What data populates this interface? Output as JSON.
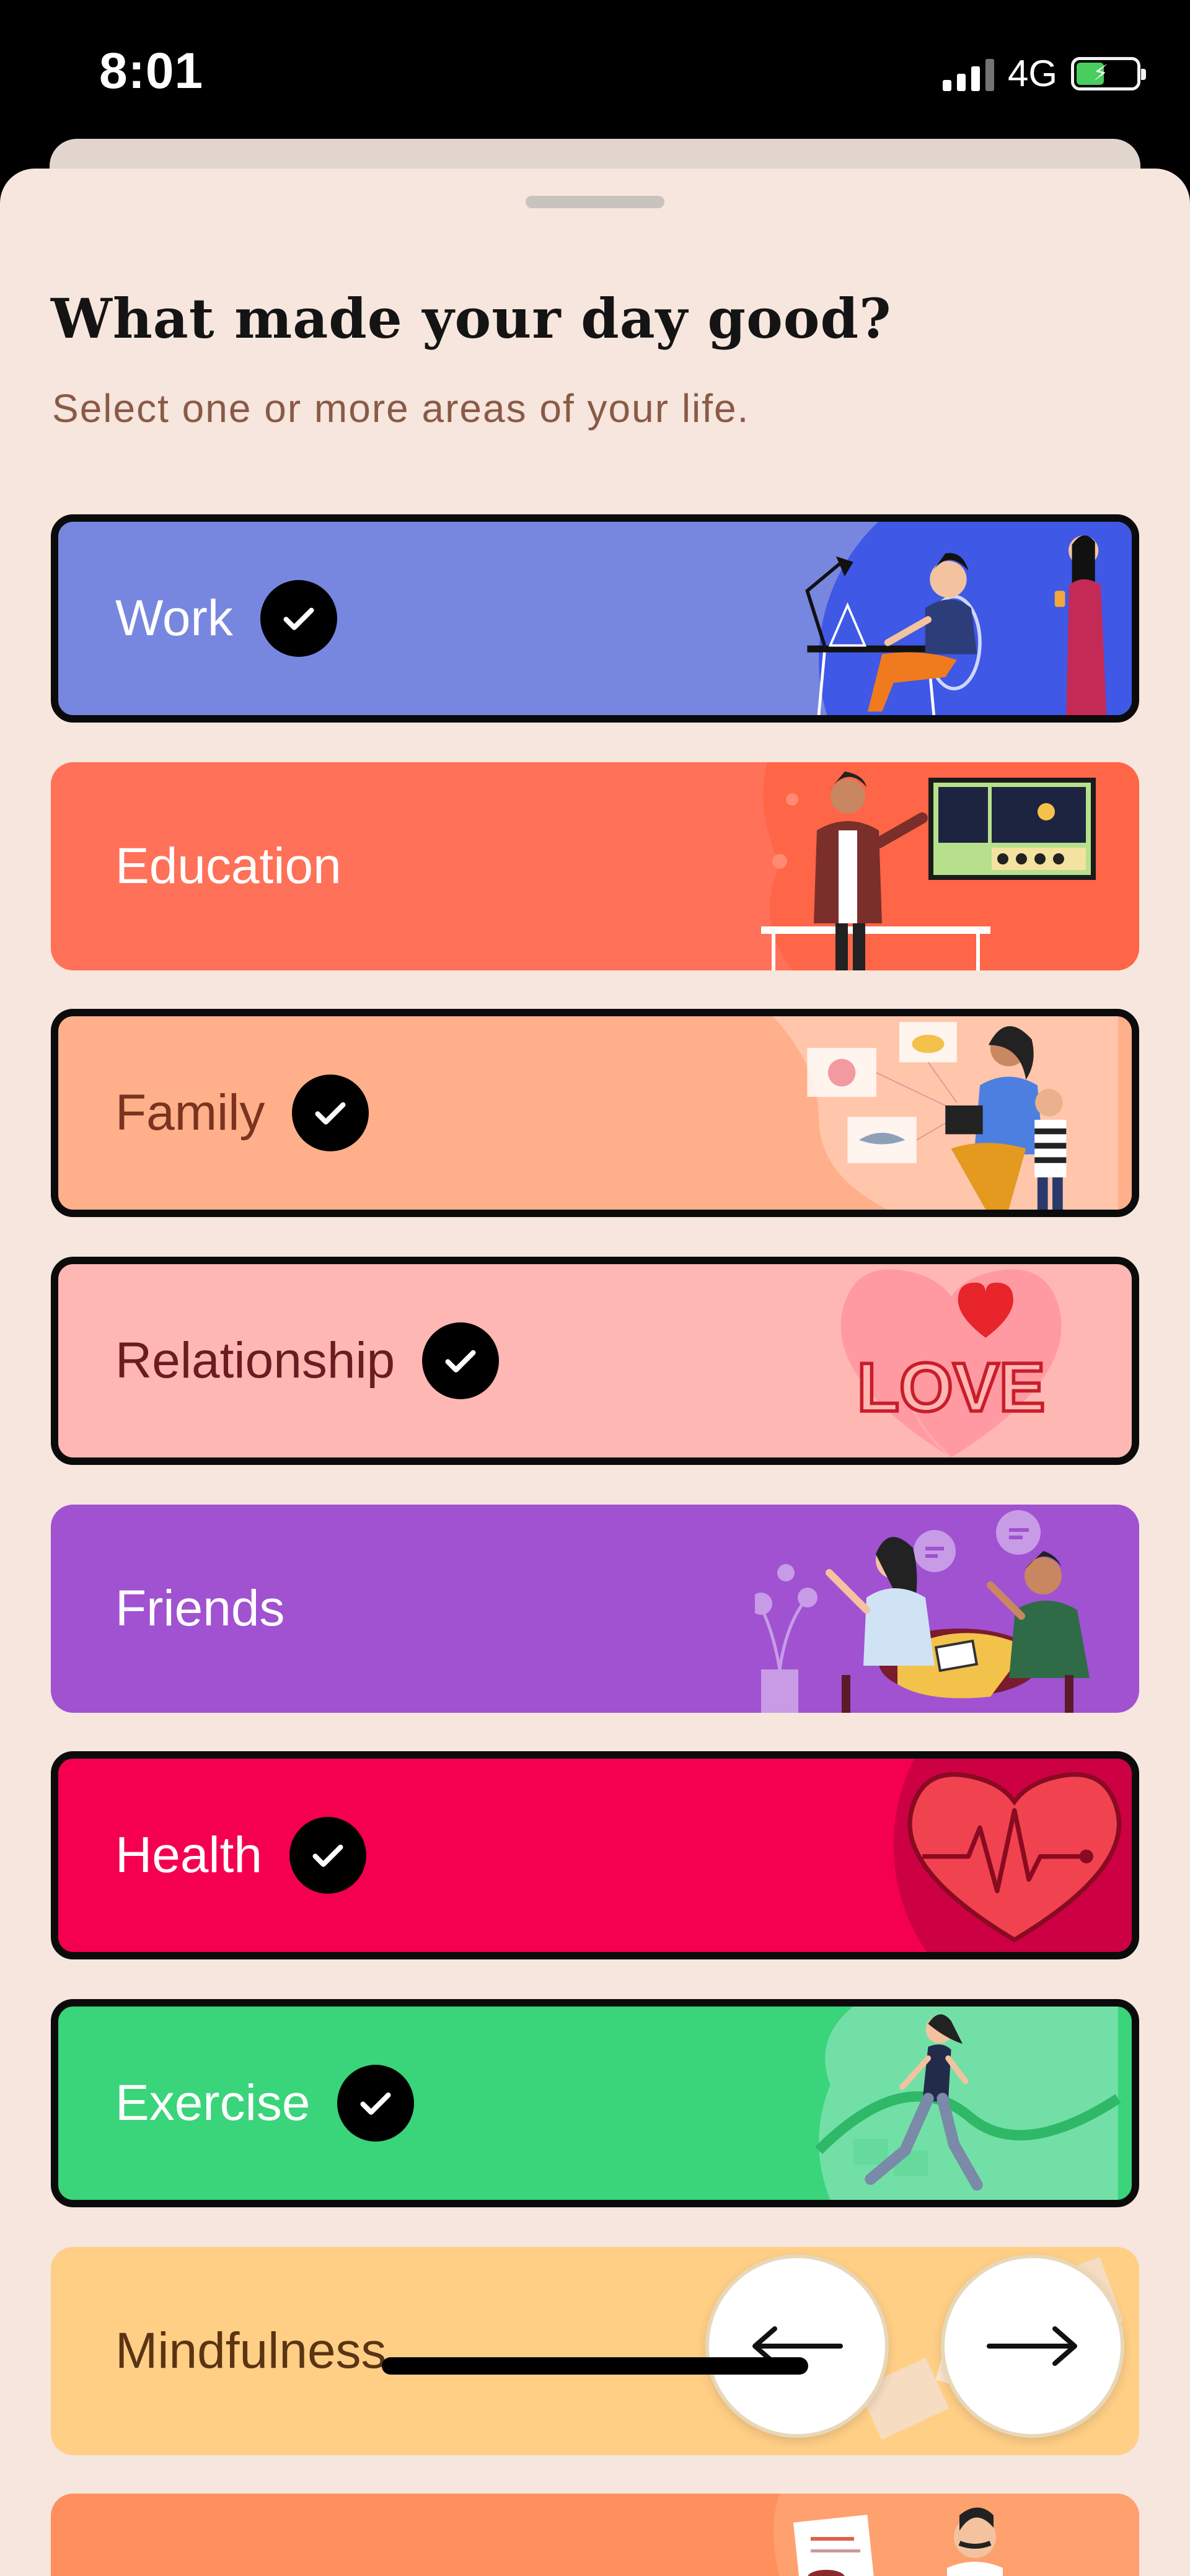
{
  "status_bar": {
    "time": "8:01",
    "network": "4G"
  },
  "sheet": {
    "title": "What made your day good?",
    "subtitle": "Select one or more areas of your life."
  },
  "categories": [
    {
      "label": "Work",
      "selected": true,
      "color": "#7787e0",
      "text_color": "#ffffff",
      "icon": "person-at-desk-illustration"
    },
    {
      "label": "Education",
      "selected": false,
      "color": "#ff7158",
      "text_color": "#ffffff",
      "icon": "teacher-board-illustration"
    },
    {
      "label": "Family",
      "selected": true,
      "color": "#ffb08a",
      "text_color": "#7a3320",
      "icon": "family-illustration"
    },
    {
      "label": "Relationship",
      "selected": true,
      "color": "#ffb7b4",
      "text_color": "#6b1c21",
      "icon": "love-heart-illustration"
    },
    {
      "label": "Friends",
      "selected": false,
      "color": "#a052d1",
      "text_color": "#ffffff",
      "icon": "friends-talking-illustration"
    },
    {
      "label": "Health",
      "selected": true,
      "color": "#f5004e",
      "text_color": "#ffffff",
      "icon": "heartbeat-illustration"
    },
    {
      "label": "Exercise",
      "selected": true,
      "color": "#3ad47a",
      "text_color": "#ffffff",
      "icon": "runner-illustration"
    },
    {
      "label": "Mindfulness",
      "selected": false,
      "color": "#ffcf86",
      "text_color": "#5a3413",
      "icon": "meditation-illustration"
    },
    {
      "label": "",
      "selected": false,
      "color": "#ff8f5c",
      "text_color": "#ffffff",
      "icon": "chef-illustration"
    }
  ],
  "navigation": {
    "back_icon": "arrow-left-icon",
    "forward_icon": "arrow-right-icon"
  }
}
